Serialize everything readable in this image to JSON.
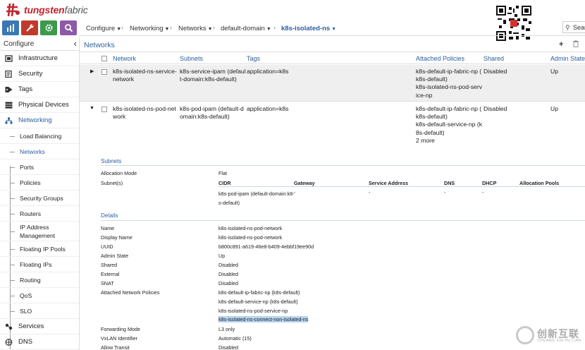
{
  "brand": {
    "name_bold": "tungsten",
    "name_thin": "fabric"
  },
  "modules": [
    {
      "name": "monitor",
      "color": "#3a78b5"
    },
    {
      "name": "configure",
      "color": "#c0392b"
    },
    {
      "name": "settings",
      "color": "#3c9a4a"
    },
    {
      "name": "query",
      "color": "#8e5aa7"
    }
  ],
  "breadcrumb": {
    "items": [
      "Configure",
      "Networking",
      "Networks",
      "default-domain",
      "k8s-isolated-ns"
    ]
  },
  "search": {
    "placeholder": "Sear"
  },
  "sidebar": {
    "title": "Configure",
    "top_items": [
      {
        "label": "Infrastructure",
        "icon": "infrastructure-icon"
      },
      {
        "label": "Security",
        "icon": "security-icon"
      },
      {
        "label": "Tags",
        "icon": "tag-icon"
      },
      {
        "label": "Physical Devices",
        "icon": "physical-devices-icon"
      },
      {
        "label": "Networking",
        "icon": "networking-icon"
      }
    ],
    "sub_items": [
      "Load Balancing",
      "Networks",
      "Ports",
      "Policies",
      "Security Groups",
      "Routers",
      "IP Address Management",
      "Floating IP Pools",
      "Floating IPs",
      "Routing",
      "QoS",
      "SLO"
    ],
    "bottom_items": [
      {
        "label": "Services",
        "icon": "services-icon"
      },
      {
        "label": "DNS",
        "icon": "dns-icon"
      }
    ]
  },
  "main": {
    "title": "Networks",
    "columns": [
      "Network",
      "Subnets",
      "Tags",
      "Attached Policies",
      "Shared",
      "Admin State"
    ],
    "rows": [
      {
        "network": [
          "k8s-isolated-ns-service-",
          "network"
        ],
        "subnets": [
          "k8s-service-ipam (defaul",
          "t-domain:k8s-default)"
        ],
        "tags": "application=k8s",
        "policies": [
          "k8s-default-ip-fabric-np (",
          "k8s-default)",
          "k8s-isolated-ns-pod-serv",
          "ice-np"
        ],
        "shared": "Disabled",
        "admin": "Up"
      },
      {
        "network": [
          "k8s-isolated-ns-pod-net",
          "work"
        ],
        "subnets": [
          "k8s-pod-ipam (default-d",
          "omain:k8s-default)"
        ],
        "tags": "application=k8s",
        "policies": [
          "k8s-default-ip-fabric-np (",
          "k8s-default)",
          "k8s-default-service-np (k",
          "8s-default)",
          "2 more"
        ],
        "shared": "Disabled",
        "admin": "Up"
      }
    ]
  },
  "detail": {
    "subnets_title": "Subnets",
    "allocation_mode_label": "Allocation Mode",
    "allocation_mode": "Flat",
    "subnets_label": "Subnet(s)",
    "subnet_cols": [
      "CIDR",
      "Gateway",
      "Service Address",
      "DNS",
      "DHCP",
      "Allocation Pools"
    ],
    "subnet_row": {
      "cidr": [
        "k8s-pod-ipam (default-domain:k8-",
        "s-default)"
      ],
      "gateway": "-",
      "service": "-",
      "dns": "-",
      "dhcp": "-"
    },
    "details_title": "Details",
    "fields": [
      {
        "k": "Name",
        "v": "k8s-isolated-ns-pod-network"
      },
      {
        "k": "Display Name",
        "v": "k8s-isolated-ns-pod-network"
      },
      {
        "k": "UUID",
        "v": "b800c891-a619-46e8-b409-4ebbf19ee90d"
      },
      {
        "k": "Admin State",
        "v": "Up"
      },
      {
        "k": "Shared",
        "v": "Disabled"
      },
      {
        "k": "External",
        "v": "Disabled"
      },
      {
        "k": "SNAT",
        "v": "Disabled"
      }
    ],
    "policies_label": "Attached Network Policies",
    "policies": [
      "k8s-default-ip-fabric-np (k8s-default)",
      "k8s-default-service-np (k8s-default)",
      "k8s-isolated-ns-pod-service-np",
      "k8s-isolated-ns-connect-non-isolated-ns"
    ],
    "fields2": [
      {
        "k": "Forwarding Mode",
        "v": "L3 only"
      },
      {
        "k": "VxLAN Identifier",
        "v": "Automatic (15)"
      },
      {
        "k": "Allow Transit",
        "v": "Disabled"
      }
    ]
  },
  "watermark": {
    "text": "创新互联",
    "sub": "CHUANG XIN HU LIAN"
  }
}
